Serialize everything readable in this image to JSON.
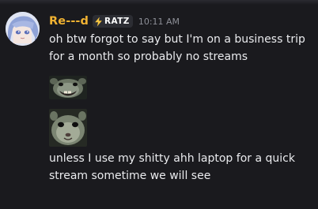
{
  "message": {
    "author": {
      "name": "Re---d",
      "name_color": "#f0b232",
      "avatar_icon": "anime-avatar"
    },
    "server_tag": {
      "icon": "lightning-bolt-icon",
      "label": "RATZ"
    },
    "timestamp": "10:11 AM",
    "lines": [
      "oh btw forgot to say but I'm on a business trip",
      "for a month so probably no streams",
      "unless I use my shitty ahh laptop for a quick",
      "stream sometime we will see"
    ],
    "emojis": [
      {
        "name": "grinning-rat-emoji"
      },
      {
        "name": "staring-rat-emoji"
      }
    ]
  },
  "colors": {
    "background": "#1a1a1e",
    "text": "#eaebee",
    "muted": "#8d8f97"
  }
}
